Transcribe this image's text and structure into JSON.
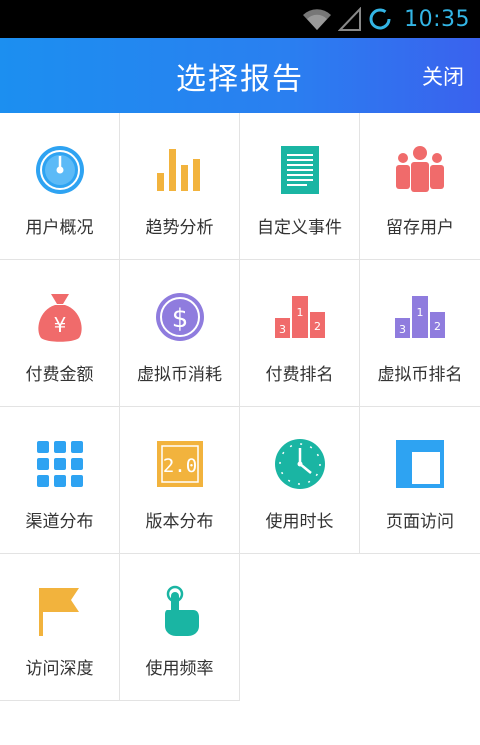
{
  "status_bar": {
    "time": "10:35",
    "icons": [
      "wifi-icon",
      "signal-icon",
      "sync-icon"
    ],
    "clock_color": "#33b5e5"
  },
  "header": {
    "title": "选择报告",
    "close_label": "关闭",
    "gradient_colors": [
      "#1c8ff0",
      "#3a62ee"
    ]
  },
  "grid": {
    "items": [
      {
        "label": "用户概况",
        "icon": "gauge-icon",
        "color": "#2ea3f2"
      },
      {
        "label": "趋势分析",
        "icon": "bar-chart-icon",
        "color": "#f2b33d"
      },
      {
        "label": "自定义事件",
        "icon": "document-icon",
        "color": "#1ab5a3"
      },
      {
        "label": "留存用户",
        "icon": "users-icon",
        "color": "#f06b6b"
      },
      {
        "label": "付费金额",
        "icon": "money-bag-icon",
        "color": "#f06b6b"
      },
      {
        "label": "虚拟币消耗",
        "icon": "dollar-coin-icon",
        "color": "#8f7cde"
      },
      {
        "label": "付费排名",
        "icon": "podium-icon",
        "color": "#f06b6b"
      },
      {
        "label": "虚拟币排名",
        "icon": "podium-icon",
        "color": "#8f7cde"
      },
      {
        "label": "渠道分布",
        "icon": "grid-dots-icon",
        "color": "#2ea3f2"
      },
      {
        "label": "版本分布",
        "icon": "version-icon",
        "color": "#f2b33d",
        "badge": "2.0"
      },
      {
        "label": "使用时长",
        "icon": "clock-icon",
        "color": "#1ab5a3"
      },
      {
        "label": "页面访问",
        "icon": "layout-icon",
        "color": "#2ea3f2"
      },
      {
        "label": "访问深度",
        "icon": "flag-icon",
        "color": "#f2b33d"
      },
      {
        "label": "使用频率",
        "icon": "tap-icon",
        "color": "#1ab5a3"
      }
    ]
  }
}
